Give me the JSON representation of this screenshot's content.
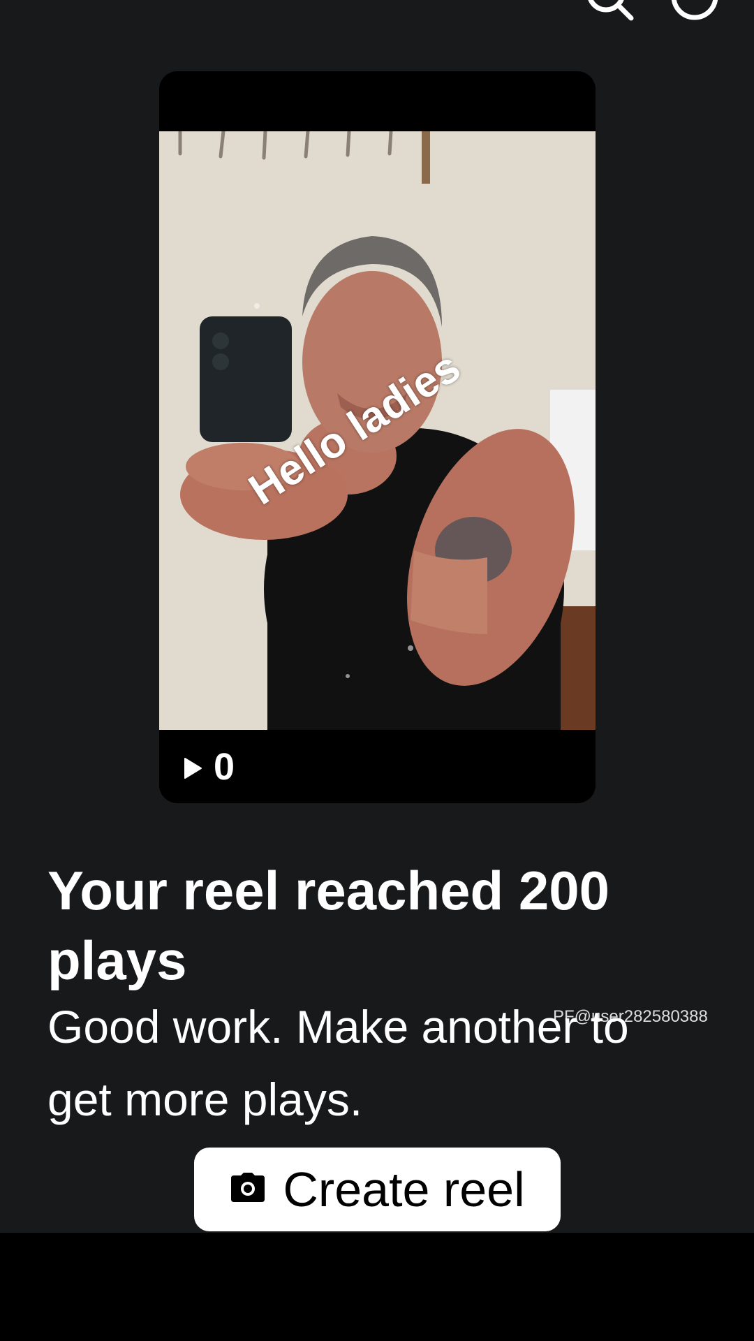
{
  "icons": {
    "search": "search-icon",
    "profile": "profile-icon",
    "play": "play-icon",
    "camera": "camera-icon"
  },
  "reel": {
    "overlay_text": "Hello ladies",
    "play_count": "0"
  },
  "milestone": {
    "title": "Your reel reached 200 plays",
    "message": "Good work. Make another to get more plays."
  },
  "watermark": "PF@user282580388",
  "create_button": {
    "label": "Create reel"
  },
  "colors": {
    "panel_background": "#18191a",
    "bottom_bar": "#000000",
    "button_background": "#ffffff",
    "text": "#ffffff"
  }
}
